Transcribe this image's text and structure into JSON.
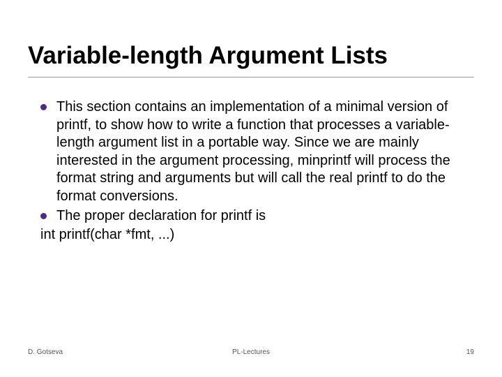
{
  "title": "Variable-length Argument Lists",
  "bullets": [
    "This section contains an implementation of a minimal version of printf, to show how to write a function that processes a variable-length argument list in a portable way. Since we are mainly interested in the argument processing, minprintf will process the format string and arguments but will call the real printf to do the format conversions.",
    "The proper declaration for printf is"
  ],
  "code_line": "int printf(char *fmt, ...)",
  "footer": {
    "left": "D. Gotseva",
    "center": "PL-Lectures",
    "right": "19"
  }
}
